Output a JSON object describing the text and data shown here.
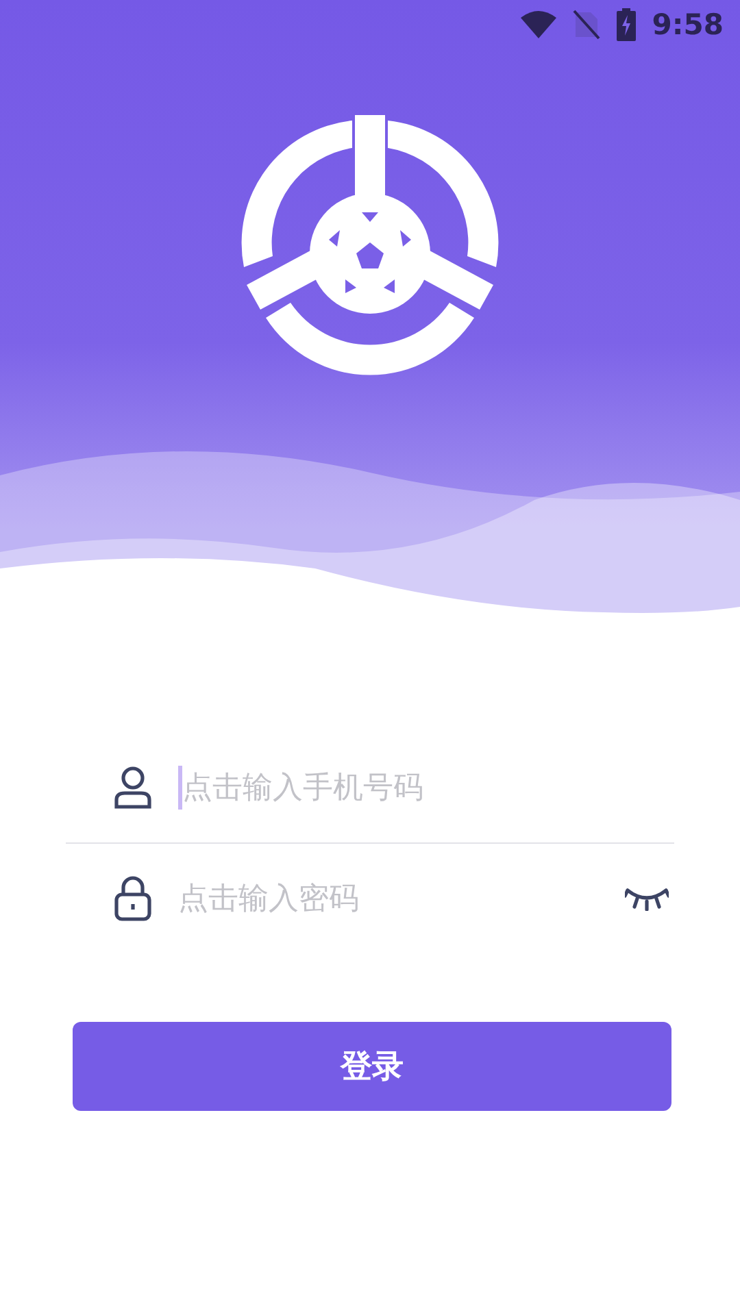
{
  "status_bar": {
    "time": "9:58"
  },
  "form": {
    "fields": [
      {
        "kind": "phone",
        "placeholder": "点击输入手机号码",
        "focused": true
      },
      {
        "kind": "password",
        "placeholder": "点击输入密码",
        "focused": false,
        "masked": true
      }
    ]
  },
  "login_button": "登录"
}
